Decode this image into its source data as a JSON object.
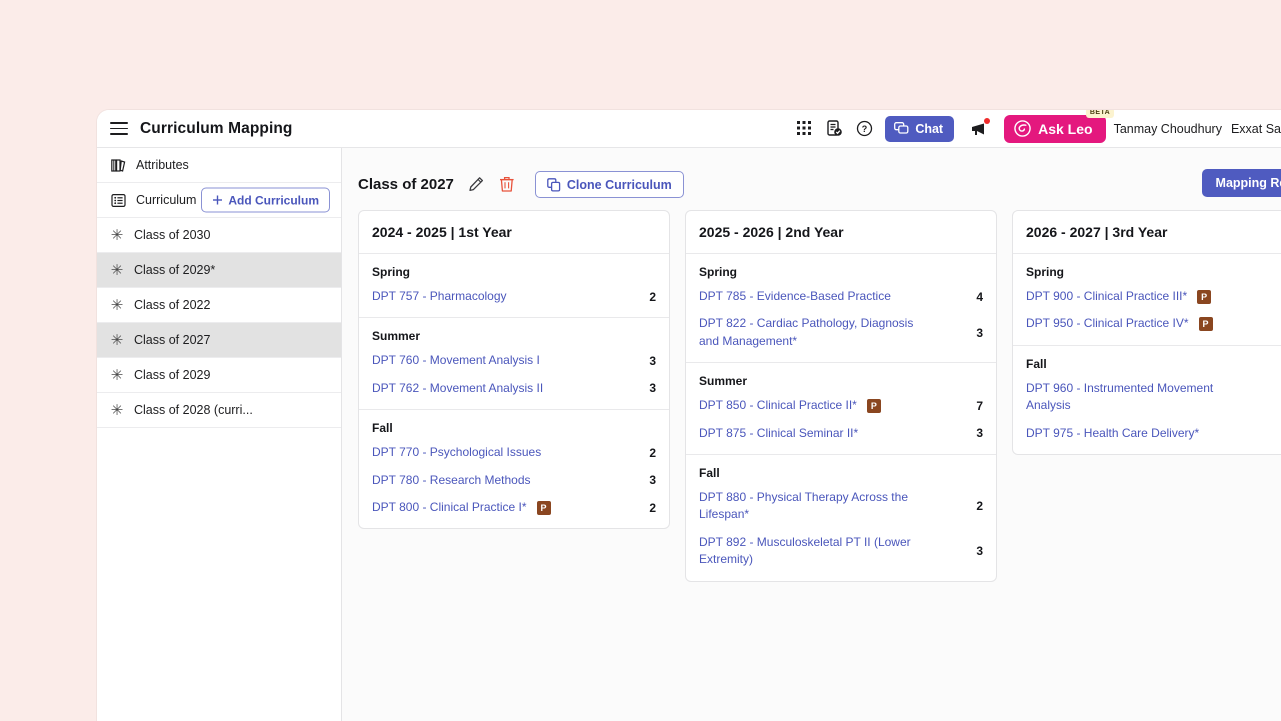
{
  "page": {
    "background_color": "#fbece9"
  },
  "topbar": {
    "menu_icon": "hamburger-icon",
    "title": "Curriculum Mapping",
    "icons": [
      {
        "name": "apps-grid-icon"
      },
      {
        "name": "report-check-icon"
      },
      {
        "name": "help-circle-icon"
      }
    ],
    "chat_label": "Chat",
    "chat_color": "#4f5bc0",
    "megaphone_icon": "megaphone-icon",
    "megaphone_has_notification": true,
    "ask_leo_label": "Ask Leo",
    "ask_leo_color": "#e4187e",
    "beta_label": "BETA",
    "user_name": "Tanmay Choudhury",
    "org_name": "Exxat Sa"
  },
  "sidebar": {
    "nav": [
      {
        "label": "Attributes",
        "icon": "books-icon"
      },
      {
        "label": "Curriculum",
        "icon": "list-icon"
      }
    ],
    "add_curriculum_label": "Add Curriculum",
    "classes": [
      {
        "label": "Class of 2030",
        "selected": false
      },
      {
        "label": "Class of 2029*",
        "selected": true
      },
      {
        "label": "Class of 2022",
        "selected": false
      },
      {
        "label": "Class of 2027",
        "selected": true
      },
      {
        "label": "Class of 2029",
        "selected": false
      },
      {
        "label": "Class of 2028 (curri...",
        "selected": false
      }
    ]
  },
  "content": {
    "title": "Class of 2027",
    "edit_icon": "pencil-icon",
    "delete_icon": "trash-icon",
    "delete_icon_color": "#e8523b",
    "clone_label": "Clone Curriculum",
    "clone_icon": "copy-icon",
    "mapping_report_label": "Mapping Rep",
    "years": [
      {
        "title": "2024 - 2025 | 1st Year",
        "terms": [
          {
            "name": "Spring",
            "courses": [
              {
                "name": "DPT 757 - Pharmacology",
                "badge": "",
                "credits": "2"
              }
            ]
          },
          {
            "name": "Summer",
            "courses": [
              {
                "name": "DPT 760 - Movement Analysis I",
                "badge": "",
                "credits": "3"
              },
              {
                "name": "DPT 762 - Movement Analysis II",
                "badge": "",
                "credits": "3"
              }
            ]
          },
          {
            "name": "Fall",
            "courses": [
              {
                "name": "DPT 770 - Psychological Issues",
                "badge": "",
                "credits": "2"
              },
              {
                "name": "DPT 780 - Research Methods",
                "badge": "",
                "credits": "3"
              },
              {
                "name": "DPT 800 - Clinical Practice I*",
                "badge": "P",
                "credits": "2"
              }
            ]
          }
        ]
      },
      {
        "title": "2025 - 2026 | 2nd Year",
        "terms": [
          {
            "name": "Spring",
            "courses": [
              {
                "name": "DPT 785 - Evidence-Based Practice",
                "badge": "",
                "credits": "4"
              },
              {
                "name": "DPT 822 - Cardiac Pathology, Diagnosis and Management*",
                "badge": "",
                "credits": "3"
              }
            ]
          },
          {
            "name": "Summer",
            "courses": [
              {
                "name": "DPT 850 - Clinical Practice II*",
                "badge": "P",
                "credits": "7"
              },
              {
                "name": "DPT 875 - Clinical Seminar II*",
                "badge": "",
                "credits": "3"
              }
            ]
          },
          {
            "name": "Fall",
            "courses": [
              {
                "name": "DPT 880 - Physical Therapy Across the Lifespan*",
                "badge": "",
                "credits": "2"
              },
              {
                "name": "DPT 892 - Musculoskeletal PT II (Lower Extremity)",
                "badge": "",
                "credits": "3"
              }
            ]
          }
        ]
      },
      {
        "title": "2026 - 2027 | 3rd Year",
        "terms": [
          {
            "name": "Spring",
            "courses": [
              {
                "name": "DPT 900 - Clinical Practice III*",
                "badge": "P",
                "credits": ""
              },
              {
                "name": "DPT 950 - Clinical Practice IV*",
                "badge": "P",
                "credits": ""
              }
            ]
          },
          {
            "name": "Fall",
            "courses": [
              {
                "name": "DPT 960 - Instrumented Movement Analysis",
                "badge": "",
                "credits": ""
              },
              {
                "name": "DPT 975 - Health Care Delivery*",
                "badge": "",
                "credits": ""
              }
            ]
          }
        ]
      }
    ]
  }
}
